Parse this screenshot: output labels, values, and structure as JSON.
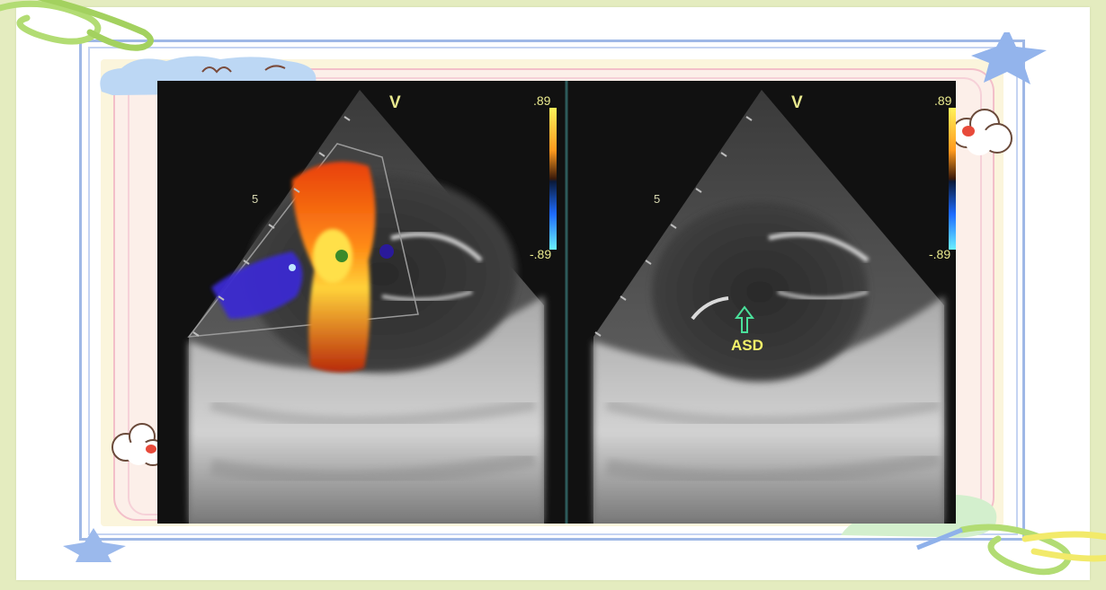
{
  "slide": {
    "background_color": "#e4ecbf",
    "paper_color": "#ffffff",
    "frame_colors": {
      "blue": "#9fb8e6",
      "cream": "#fbf5dc",
      "pink": "#f3bfc9"
    }
  },
  "decorations": [
    {
      "name": "paperclip-icon",
      "color": "#a8d96a"
    },
    {
      "name": "cloud-doodle-icon",
      "color": "#b9d4f3"
    },
    {
      "name": "star-icon",
      "color": "#8fb1ea"
    },
    {
      "name": "flower-icon",
      "color": "#ffffff"
    },
    {
      "name": "leaf-icon",
      "color": "#cfeec8"
    }
  ],
  "ultrasound": {
    "left_panel": {
      "mode_label": "V",
      "scale_top": ".89",
      "scale_bottom": "-.89",
      "depth_marker": "5"
    },
    "right_panel": {
      "mode_label": "V",
      "scale_top": ".89",
      "scale_bottom": "-.89",
      "depth_marker": "5",
      "annotation": "ASD",
      "arrow_icon": "up-arrow-icon",
      "annotation_color": "#f4f26a"
    }
  }
}
